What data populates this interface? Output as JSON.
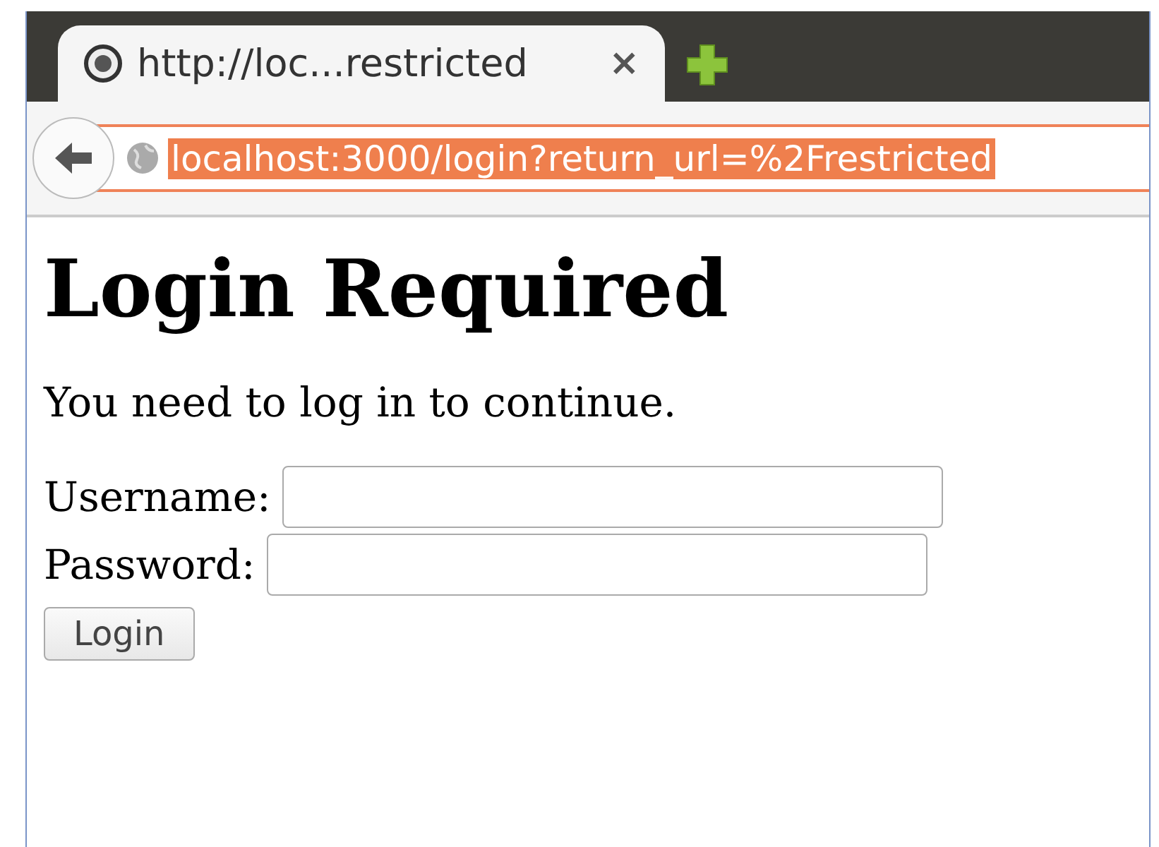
{
  "tab": {
    "title": "http://loc...restricted",
    "close": "×"
  },
  "address_bar": {
    "url": "localhost:3000/login?return_url=%2Frestricted",
    "selected": true
  },
  "page": {
    "heading": "Login Required",
    "message": "You need to log in to continue.",
    "fields": [
      {
        "label": "Username:"
      },
      {
        "label": "Password:"
      }
    ],
    "button": "Login"
  }
}
